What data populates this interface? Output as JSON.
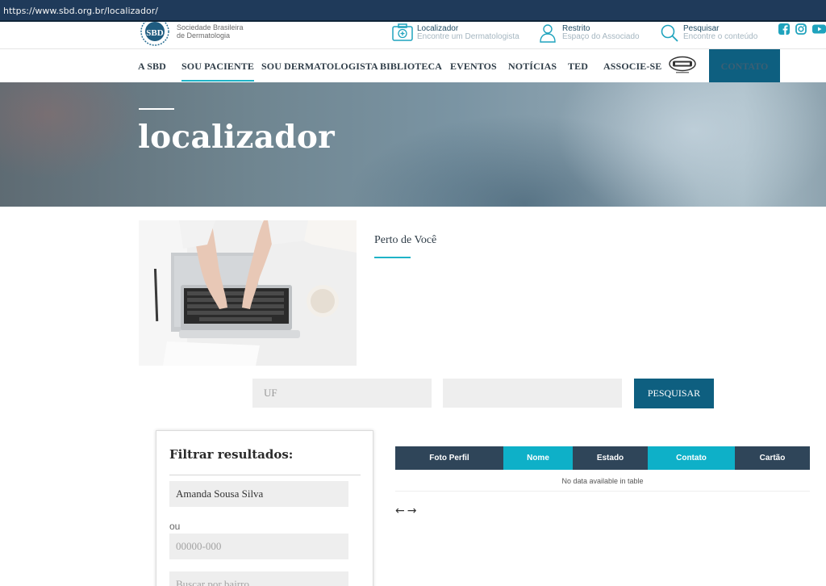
{
  "browser": {
    "url": "https://www.sbd.org.br/localizador/"
  },
  "header": {
    "logo_text_line1": "Sociedade Brasileira",
    "logo_text_line2": "de Dermatologia",
    "localizador": {
      "title": "Localizador",
      "subtitle": "Encontre um Dermatologista",
      "icon": "medkit-icon"
    },
    "restrito": {
      "title": "Restrito",
      "subtitle": "Espaço do Associado",
      "icon": "user-icon"
    },
    "pesquisar": {
      "title": "Pesquisar",
      "subtitle": "Encontre o conteúdo",
      "icon": "search-icon"
    },
    "social": [
      "facebook-icon",
      "instagram-icon",
      "youtube-icon"
    ]
  },
  "nav": {
    "items": [
      "A SBD",
      "SOU PACIENTE",
      "SOU DERMATOLOGISTA",
      "BIBLIOTECA",
      "EVENTOS",
      "NOTÍCIAS",
      "TED",
      "ASSOCIE-SE"
    ],
    "active": "SOU PACIENTE",
    "contato": "CONTATO"
  },
  "hero": {
    "title": "localizador"
  },
  "section": {
    "heading": "Perto de Você"
  },
  "search": {
    "uf_placeholder": "UF",
    "city_placeholder": "",
    "button": "PESQUISAR"
  },
  "filter": {
    "title": "Filtrar resultados:",
    "name_value": "Amanda Sousa Silva",
    "ou": "ou",
    "cep_placeholder": "00000-000",
    "bairro_placeholder": "Buscar por bairro"
  },
  "table": {
    "columns": [
      "Foto Perfil",
      "Nome",
      "Estado",
      "Contato",
      "Cartão"
    ],
    "empty_message": "No data available in table"
  },
  "colors": {
    "primary": "#0e5f80",
    "accent": "#1fb3c7",
    "dark": "#2f4559"
  }
}
